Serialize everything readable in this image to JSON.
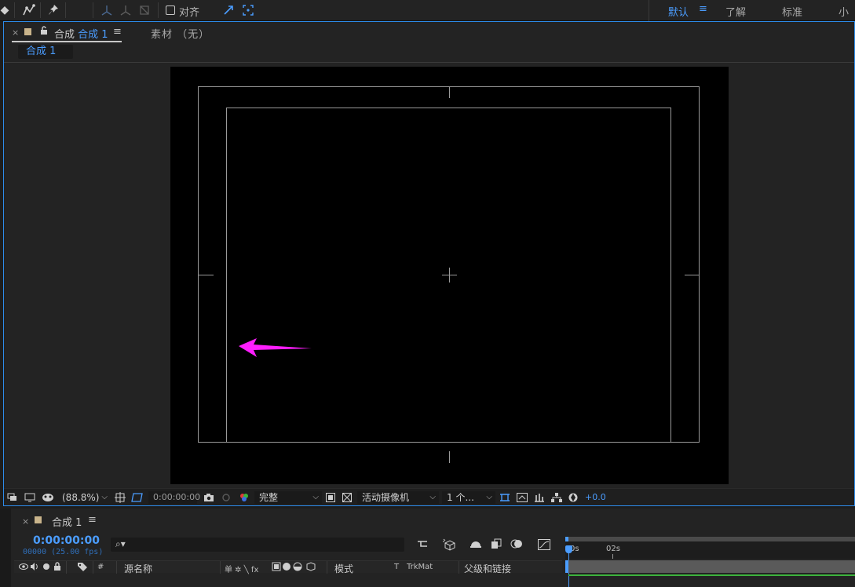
{
  "toolbar": {
    "snap_label": "对齐",
    "icons": [
      "pen-icon",
      "puppet-pin-icon",
      "pin-icon",
      "axis-icon",
      "snap-box-icon"
    ]
  },
  "workspaces": {
    "default": "默认",
    "menu_icon": "≡",
    "learn": "了解",
    "standard": "标准",
    "small_screen": "小屏"
  },
  "comp_panel": {
    "close": "×",
    "tab_prefix": "合成",
    "tab_name": "合成 1",
    "tab_menu": "≡",
    "footage_tab": "素材 （无）",
    "breadcrumb": "合成 1"
  },
  "viewer_bar": {
    "zoom": "(88.8%)",
    "timecode": "0:00:00:00",
    "resolution": "完整",
    "camera": "活动摄像机",
    "views": "1 个...",
    "exposure": "+0.0"
  },
  "timeline": {
    "close": "×",
    "title": "合成 1",
    "menu": "≡",
    "timecode": "0:00:00:00",
    "fps_info": "00000 (25.00 fps)",
    "columns": {
      "number": "#",
      "source_name": "源名称",
      "switch_symbols": "单 ✲ ╲ fx",
      "mode": "模式",
      "t": "T",
      "trkmat": "TrkMat",
      "parent": "父级和链接"
    },
    "ruler": [
      "0s",
      "02s"
    ]
  },
  "colors": {
    "accent": "#2d8ceb",
    "highlight_text": "#4b9dff",
    "arrow": "#ff1eff",
    "comp_swatch": "#c9b48b",
    "green_bar": "#3cb43c"
  }
}
